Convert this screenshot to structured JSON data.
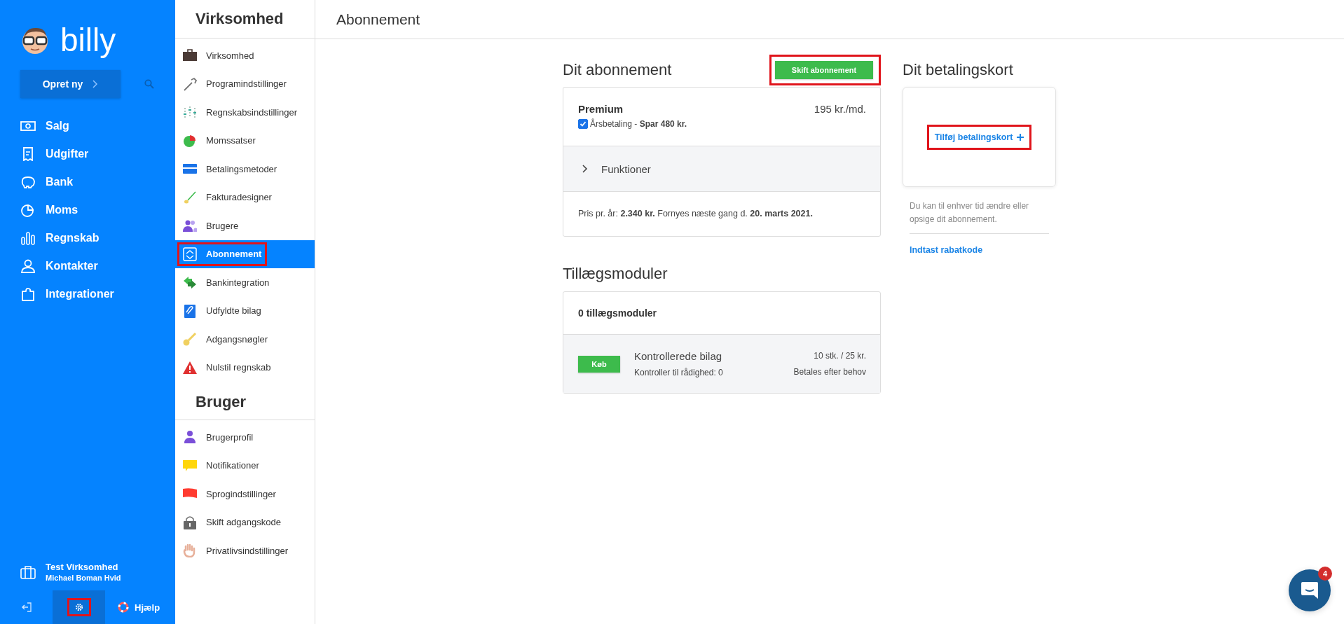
{
  "sidebar": {
    "logo": "billy",
    "create_button": {
      "label": "Opret ny"
    },
    "nav": [
      {
        "label": "Salg"
      },
      {
        "label": "Udgifter"
      },
      {
        "label": "Bank"
      },
      {
        "label": "Moms"
      },
      {
        "label": "Regnskab"
      },
      {
        "label": "Kontakter"
      },
      {
        "label": "Integrationer"
      }
    ],
    "company": "Test Virksomhed",
    "user": "Michael Boman Hvid",
    "settings_button": {
      "selected": true,
      "highlighted": true
    },
    "help": "Hjælp"
  },
  "settings_menu": {
    "sections": [
      {
        "title": "Virksomhed",
        "items": [
          {
            "label": "Virksomhed",
            "selected": false,
            "highlighted": false
          },
          {
            "label": "Programindstillinger",
            "selected": false,
            "highlighted": false
          },
          {
            "label": "Regnskabsindstillinger",
            "selected": false,
            "highlighted": false
          },
          {
            "label": "Momssatser",
            "selected": false,
            "highlighted": false
          },
          {
            "label": "Betalingsmetoder",
            "selected": false,
            "highlighted": false
          },
          {
            "label": "Fakturadesigner",
            "selected": false,
            "highlighted": false
          },
          {
            "label": "Brugere",
            "selected": false,
            "highlighted": false
          },
          {
            "label": "Abonnement",
            "selected": true,
            "highlighted": true
          },
          {
            "label": "Bankintegration",
            "selected": false,
            "highlighted": false
          },
          {
            "label": "Udfyldte bilag",
            "selected": false,
            "highlighted": false
          },
          {
            "label": "Adgangsnøgler",
            "selected": false,
            "highlighted": false
          },
          {
            "label": "Nulstil regnskab",
            "selected": false,
            "highlighted": false
          }
        ]
      },
      {
        "title": "Bruger",
        "items": [
          {
            "label": "Brugerprofil",
            "selected": false,
            "highlighted": false
          },
          {
            "label": "Notifikationer",
            "selected": false,
            "highlighted": false
          },
          {
            "label": "Sprogindstillinger",
            "selected": false,
            "highlighted": false
          },
          {
            "label": "Skift adgangskode",
            "selected": false,
            "highlighted": false
          },
          {
            "label": "Privatlivsindstillinger",
            "selected": false,
            "highlighted": false
          }
        ]
      }
    ]
  },
  "header": {
    "title": "Abonnement"
  },
  "subscription": {
    "title": "Dit abonnement",
    "change_button": {
      "label": "Skift abonnement",
      "highlighted": true
    },
    "plan": "Premium",
    "price": "195 kr./md.",
    "yearly": {
      "label": "Årsbetaling - **Spar 480 kr.**",
      "checked": true
    },
    "features": {
      "label": "Funktioner",
      "expanded": false
    },
    "summary": "Pris pr. år: **2.340 kr.** Fornyes næste gang d. **20. marts 2021.**"
  },
  "addons": {
    "title": "Tillægsmoduler",
    "count": "0 tillægsmoduler",
    "modules": [
      {
        "button": "Køb",
        "name": "Kontrollerede bilag",
        "detail": "Kontroller til rådighed: 0",
        "price": "10 stk. / 25 kr.",
        "billing": "Betales efter behov"
      }
    ]
  },
  "payment": {
    "title": "Dit betalingskort",
    "add_card": {
      "label": "Tilføj betalingskort",
      "highlighted": true
    },
    "note": "Du kan til enhver tid ændre eller opsige dit abonnement.",
    "discount_link": "Indtast rabatkode"
  },
  "chat": {
    "badge": "4"
  }
}
